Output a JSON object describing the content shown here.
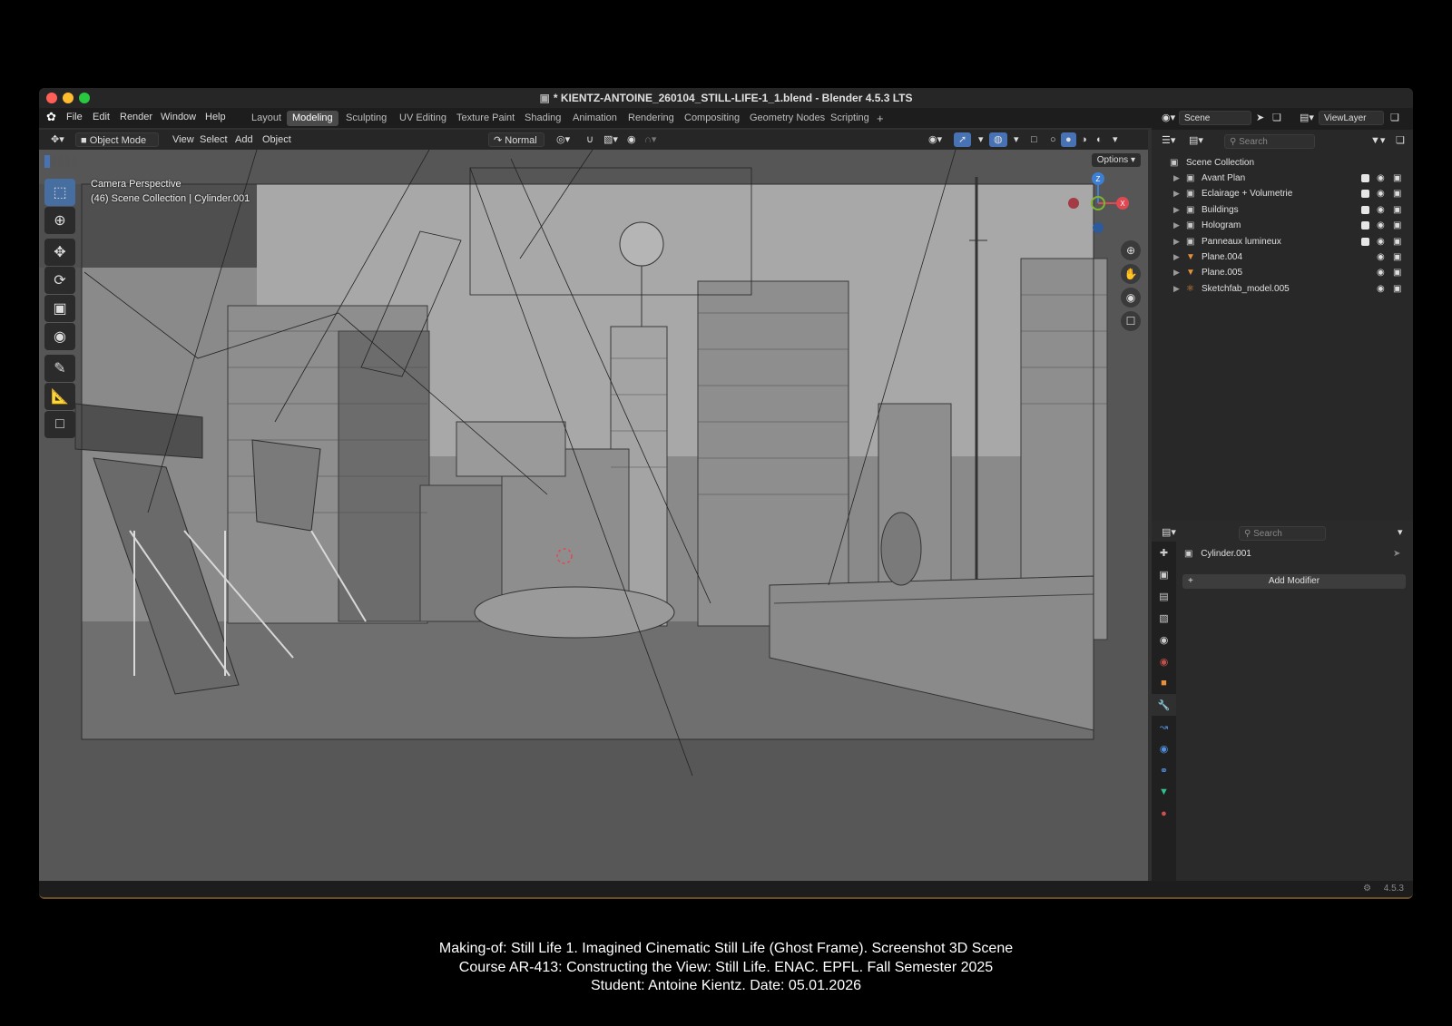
{
  "window": {
    "title": "* KIENTZ-ANTOINE_260104_STILL-LIFE-1_1.blend - Blender 4.5.3 LTS"
  },
  "menu": {
    "items": [
      "File",
      "Edit",
      "Render",
      "Window",
      "Help"
    ]
  },
  "workspaces": [
    "Layout",
    "Modeling",
    "Sculpting",
    "UV Editing",
    "Texture Paint",
    "Shading",
    "Animation",
    "Rendering",
    "Compositing",
    "Geometry Nodes",
    "Scripting",
    "+"
  ],
  "active_workspace": "Modeling",
  "scene_selector": {
    "scene": "Scene",
    "view_layer": "ViewLayer"
  },
  "header3d": {
    "mode": "Object Mode",
    "menus": [
      "View",
      "Select",
      "Add",
      "Object"
    ],
    "orientation": "Normal",
    "options": "Options"
  },
  "viewport": {
    "perspective": "Camera Perspective",
    "selection": "(46) Scene Collection | Cylinder.001",
    "axes": {
      "z": "Z",
      "x": "X"
    }
  },
  "outliner": {
    "search_placeholder": "Search",
    "root": "Scene Collection",
    "items": [
      {
        "name": "Avant Plan",
        "checked": true
      },
      {
        "name": "Eclairage + Volumetrie",
        "checked": true
      },
      {
        "name": "Buildings",
        "checked": true
      },
      {
        "name": "Hologram",
        "checked": true
      },
      {
        "name": "Panneaux lumineux",
        "checked": true
      },
      {
        "name": "Plane.004",
        "checked": false
      },
      {
        "name": "Plane.005",
        "checked": false
      },
      {
        "name": "Sketchfab_model.005",
        "checked": false
      }
    ]
  },
  "properties": {
    "search_placeholder": "Search",
    "object": "Cylinder.001",
    "add_modifier": "Add Modifier"
  },
  "statusbar": {
    "version": "4.5.3"
  },
  "caption": {
    "line1": "Making-of: Still Life 1. Imagined Cinematic Still Life (Ghost Frame). Screenshot 3D Scene",
    "line2": "Course AR-413: Constructing the View: Still Life. ENAC. EPFL. Fall Semester 2025",
    "line3": "Student: Antoine Kientz. Date: 05.01.2026"
  },
  "colors": {
    "accent": "#4772b3",
    "x_axis": "#e04852",
    "y_axis": "#7fb532",
    "z_axis": "#3e7fd6",
    "object_icon": "#e8913c",
    "mesh_icon": "#34c08c"
  }
}
